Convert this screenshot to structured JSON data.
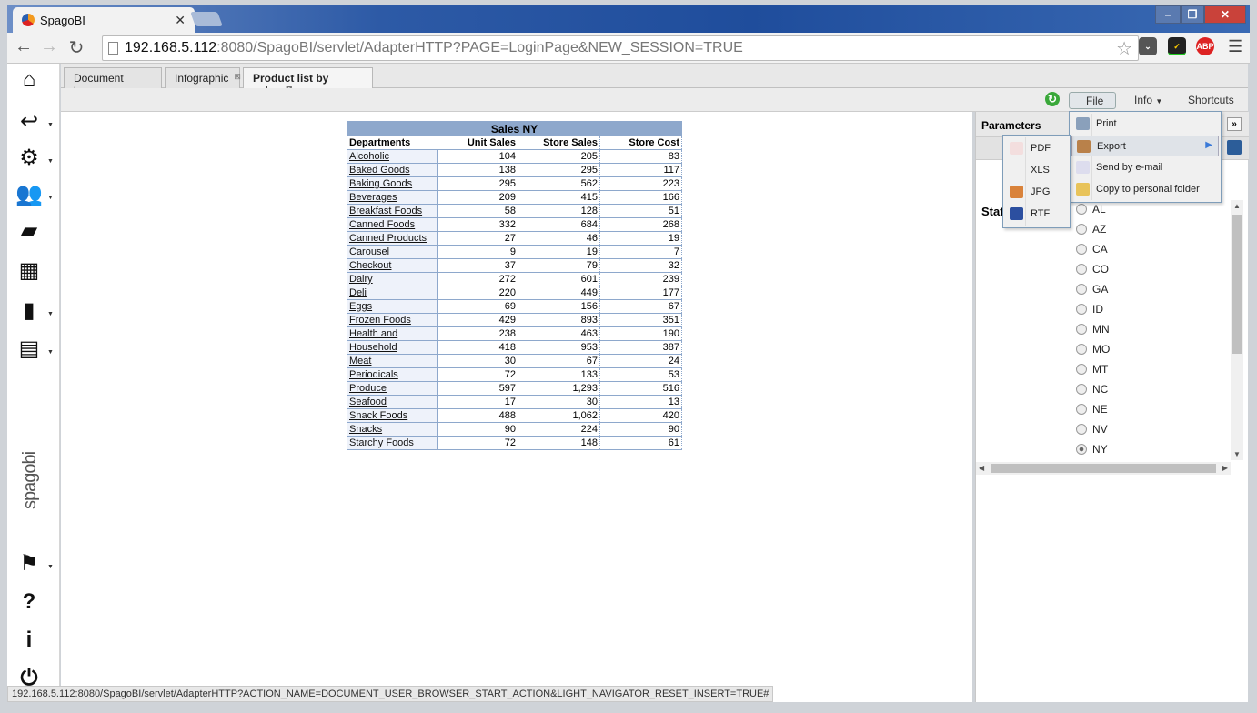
{
  "browser": {
    "tab_title": "SpagoBI",
    "url_host": "192.168.5.112",
    "url_rest": ":8080/SpagoBI/servlet/AdapterHTTP?PAGE=LoginPage&NEW_SESSION=TRUE",
    "status_url": "192.168.5.112:8080/SpagoBI/servlet/AdapterHTTP?ACTION_NAME=DOCUMENT_USER_BROWSER_START_ACTION&LIGHT_NAVIGATOR_RESET_INSERT=TRUE#",
    "ext_abp": "ABP"
  },
  "sidebar": {
    "icons": [
      "home-icon",
      "arrow-icon",
      "gears-icon",
      "users-icon",
      "folder-icon",
      "table-icon",
      "chart-icon",
      "cube-icon",
      "flag-icon",
      "help-icon",
      "info-icon",
      "power-icon"
    ],
    "logo": "spagobi"
  },
  "doc_tabs": [
    {
      "label": "Document browser"
    },
    {
      "label": "Infographic"
    },
    {
      "label": "Product list by sales"
    }
  ],
  "menubar": {
    "file": "File",
    "info": "Info",
    "shortcuts": "Shortcuts"
  },
  "file_menu": [
    "Print",
    "Export",
    "Send by e-mail",
    "Copy to personal folder"
  ],
  "export_menu": [
    "PDF",
    "XLS",
    "JPG",
    "RTF"
  ],
  "report": {
    "title": "Sales NY",
    "columns": [
      "Departments",
      "Unit Sales",
      "Store Sales",
      "Store Cost"
    ],
    "rows": [
      [
        "Alcoholic",
        "104",
        "205",
        "83"
      ],
      [
        "Baked Goods",
        "138",
        "295",
        "117"
      ],
      [
        "Baking Goods",
        "295",
        "562",
        "223"
      ],
      [
        "Beverages",
        "209",
        "415",
        "166"
      ],
      [
        "Breakfast Foods",
        "58",
        "128",
        "51"
      ],
      [
        "Canned Foods",
        "332",
        "684",
        "268"
      ],
      [
        "Canned Products",
        "27",
        "46",
        "19"
      ],
      [
        "Carousel",
        "9",
        "19",
        "7"
      ],
      [
        "Checkout",
        "37",
        "79",
        "32"
      ],
      [
        "Dairy",
        "272",
        "601",
        "239"
      ],
      [
        "Deli",
        "220",
        "449",
        "177"
      ],
      [
        "Eggs",
        "69",
        "156",
        "67"
      ],
      [
        "Frozen Foods",
        "429",
        "893",
        "351"
      ],
      [
        "Health and",
        "238",
        "463",
        "190"
      ],
      [
        "Household",
        "418",
        "953",
        "387"
      ],
      [
        "Meat",
        "30",
        "67",
        "24"
      ],
      [
        "Periodicals",
        "72",
        "133",
        "53"
      ],
      [
        "Produce",
        "597",
        "1,293",
        "516"
      ],
      [
        "Seafood",
        "17",
        "30",
        "13"
      ],
      [
        "Snack Foods",
        "488",
        "1,062",
        "420"
      ],
      [
        "Snacks",
        "90",
        "224",
        "90"
      ],
      [
        "Starchy Foods",
        "72",
        "148",
        "61"
      ]
    ]
  },
  "parameters": {
    "title": "Parameters",
    "state_label": "Stat",
    "states": [
      "AL",
      "AZ",
      "CA",
      "CO",
      "GA",
      "ID",
      "MN",
      "MO",
      "MT",
      "NC",
      "NE",
      "NV",
      "NY"
    ],
    "selected": "NY"
  }
}
